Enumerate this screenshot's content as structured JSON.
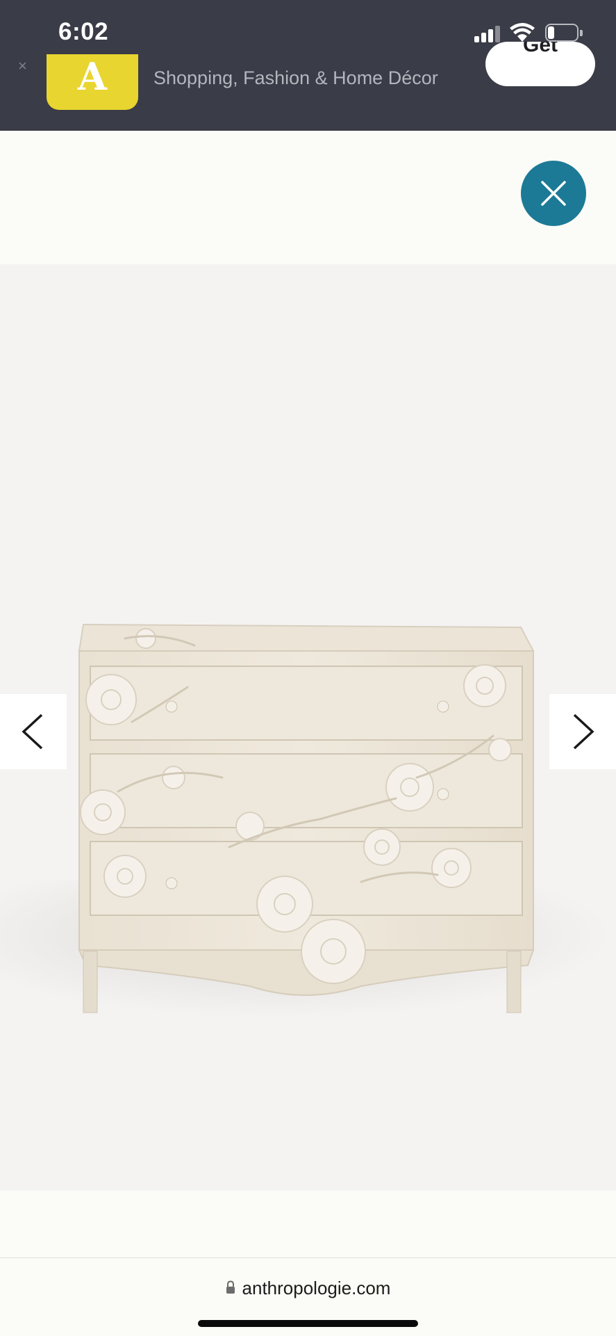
{
  "status_bar": {
    "time": "6:02",
    "icons": [
      "cellular-signal-icon",
      "wifi-icon",
      "battery-icon"
    ]
  },
  "app_banner": {
    "close_glyph": "×",
    "app_icon_letter": "A",
    "subtitle": "Shopping, Fashion & Home Décor",
    "get_label": "Get"
  },
  "modal": {
    "close_icon": "close-icon",
    "accent_color": "#1c7a96"
  },
  "gallery": {
    "product_image": "carved floral white dresser",
    "prev_icon": "chevron-left-icon",
    "next_icon": "chevron-right-icon"
  },
  "browser": {
    "url": "anthropologie.com",
    "lock_icon": "lock-icon"
  }
}
